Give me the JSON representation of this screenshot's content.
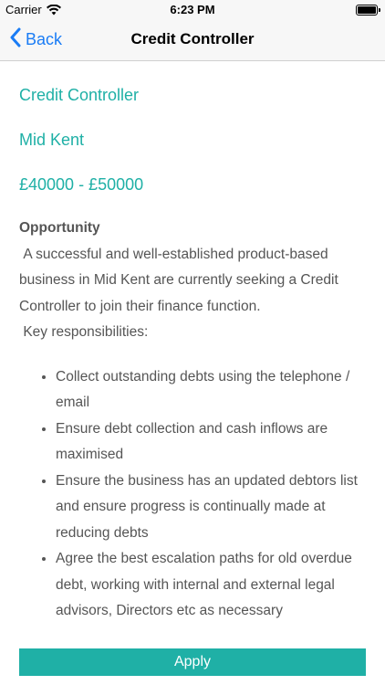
{
  "status_bar": {
    "carrier": "Carrier",
    "time": "6:23 PM"
  },
  "nav": {
    "back_label": "Back",
    "title": "Credit Controller"
  },
  "job": {
    "title": "Credit Controller",
    "location": "Mid Kent",
    "salary": "£40000 - £50000"
  },
  "description": {
    "heading": "Opportunity",
    "intro": " A successful and well-established product-based business in Mid Kent are currently seeking a Credit Controller to join their finance function.",
    "resp_heading": " Key responsibilities:",
    "responsibilities": [
      "Collect outstanding debts using the telephone / email",
      "Ensure debt collection and cash inflows are maximised",
      "Ensure the business has an updated debtors list and ensure progress is continually made at reducing debts",
      "Agree the best escalation paths for old overdue debt, working with internal and external legal advisors, Directors etc as necessary"
    ]
  },
  "apply": {
    "label": "Apply"
  },
  "colors": {
    "accent": "#1fb0a6",
    "link": "#1a7cf5"
  }
}
